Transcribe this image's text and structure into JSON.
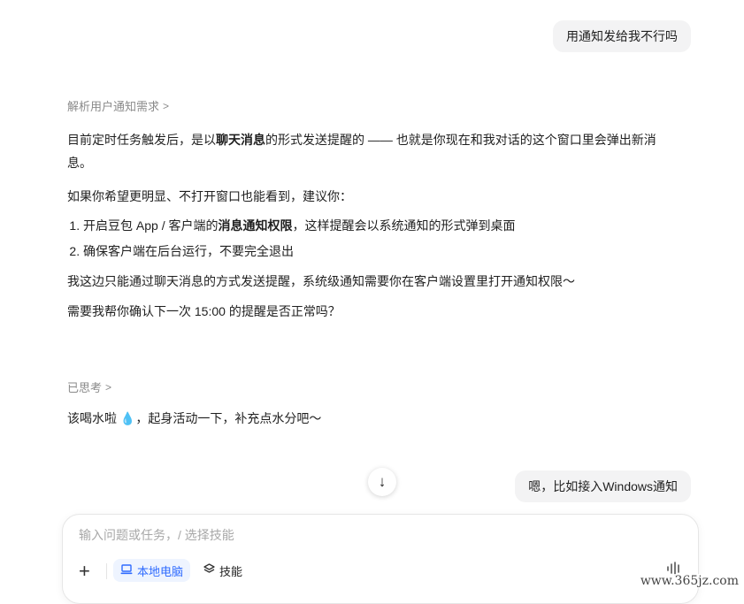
{
  "conversation": {
    "user_msg_1": "用通知发给我不行吗",
    "think_1": "解析用户通知需求",
    "answer_1": {
      "p1_a": "目前定时任务触发后，是以",
      "p1_bold": "聊天消息",
      "p1_b": "的形式发送提醒的 —— 也就是你现在和我对话的这个窗口里会弹出新消息。",
      "p2": "如果你希望更明显、不打开窗口也能看到，建议你：",
      "li1_a": "开启豆包 App / 客户端的",
      "li1_bold": "消息通知权限",
      "li1_b": "，这样提醒会以系统通知的形式弹到桌面",
      "li2": "确保客户端在后台运行，不要完全退出",
      "p3": "我这边只能通过聊天消息的方式发送提醒，系统级通知需要你在客户端设置里打开通知权限～",
      "p4": "需要我帮你确认下一次 15:00 的提醒是否正常吗？"
    },
    "think_2": "已思考",
    "answer_2": {
      "text_a": "该喝水啦 ",
      "emoji": "💧",
      "text_b": "，起身活动一下，补充点水分吧～"
    },
    "user_msg_2": "嗯，比如接入Windows通知"
  },
  "composer": {
    "placeholder": "输入问题或任务，/ 选择技能",
    "local_label": "本地电脑",
    "skills_label": "技能"
  },
  "icons": {
    "chevron": "chevron-right-icon",
    "scroll": "arrow-down-icon",
    "attach": "plus-icon",
    "local": "laptop-icon",
    "skills": "layers-icon",
    "voice": "waveform-icon"
  },
  "colors": {
    "accent": "#2f6bff",
    "bubble_bg": "#f3f3f4",
    "muted": "#8a8a8a"
  },
  "watermark": "www.365jz.com"
}
